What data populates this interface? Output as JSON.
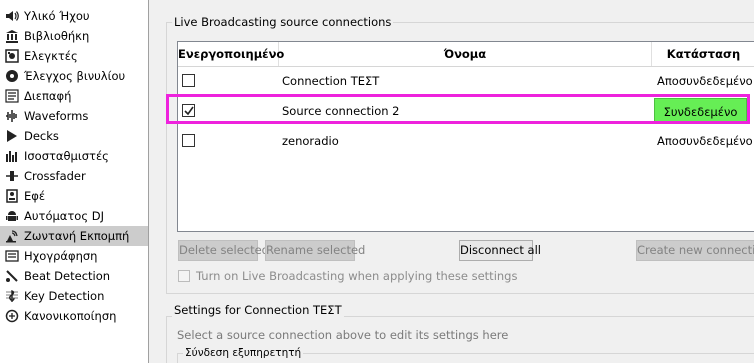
{
  "sidebar": {
    "items": [
      {
        "label": "Υλικό Ήχου",
        "icon": "speaker-icon"
      },
      {
        "label": "Βιβλιοθήκη",
        "icon": "library-icon"
      },
      {
        "label": "Ελεγκτές",
        "icon": "controller-icon"
      },
      {
        "label": "Έλεγχος βινυλίου",
        "icon": "vinyl-icon"
      },
      {
        "label": "Διεπαφή",
        "icon": "interface-icon"
      },
      {
        "label": "Waveforms",
        "icon": "waveform-icon"
      },
      {
        "label": "Decks",
        "icon": "play-icon"
      },
      {
        "label": "Ισοσταθμιστές",
        "icon": "equalizer-icon"
      },
      {
        "label": "Crossfader",
        "icon": "crossfader-icon"
      },
      {
        "label": "Εφέ",
        "icon": "effects-icon"
      },
      {
        "label": "Αυτόματος DJ",
        "icon": "android-icon"
      },
      {
        "label": "Ζωντανή Εκπομπή",
        "icon": "broadcast-icon",
        "selected": true
      },
      {
        "label": "Ηχογράφηση",
        "icon": "recording-icon"
      },
      {
        "label": "Beat Detection",
        "icon": "beat-detection-icon"
      },
      {
        "label": "Key Detection",
        "icon": "treble-clef-icon"
      },
      {
        "label": "Κανονικοποίηση",
        "icon": "normalization-icon"
      }
    ]
  },
  "connections_group": {
    "title": "Live Broadcasting source connections",
    "columns": {
      "enabled": "Ενεργοποιημένο",
      "name": "Όνομα",
      "status": "Κατάσταση"
    },
    "rows": [
      {
        "enabled": false,
        "name": "Connection ΤΕΣΤ",
        "status": "Αποσυνδεδεμένο",
        "connected": false
      },
      {
        "enabled": true,
        "name": "Source connection 2",
        "status": "Συνδεδεμένο",
        "connected": true
      },
      {
        "enabled": false,
        "name": "zenoradio",
        "status": "Αποσυνδεδεμένο",
        "connected": false
      }
    ],
    "buttons": {
      "delete": "Delete selected",
      "rename": "Rename selected",
      "disconnect": "Disconnect all",
      "create": "Create new connection"
    },
    "onair_label": "Turn on Live Broadcasting when applying these settings"
  },
  "settings_group": {
    "title": "Settings for Connection ΤΕΣΤ",
    "hint": "Select a source connection above to edit its settings here",
    "server_title": "Σύνδεση εξυπηρετητή"
  },
  "colors": {
    "connected": "#66ee55",
    "highlight": "#ee22dd",
    "selected_item": "#cccccc"
  }
}
